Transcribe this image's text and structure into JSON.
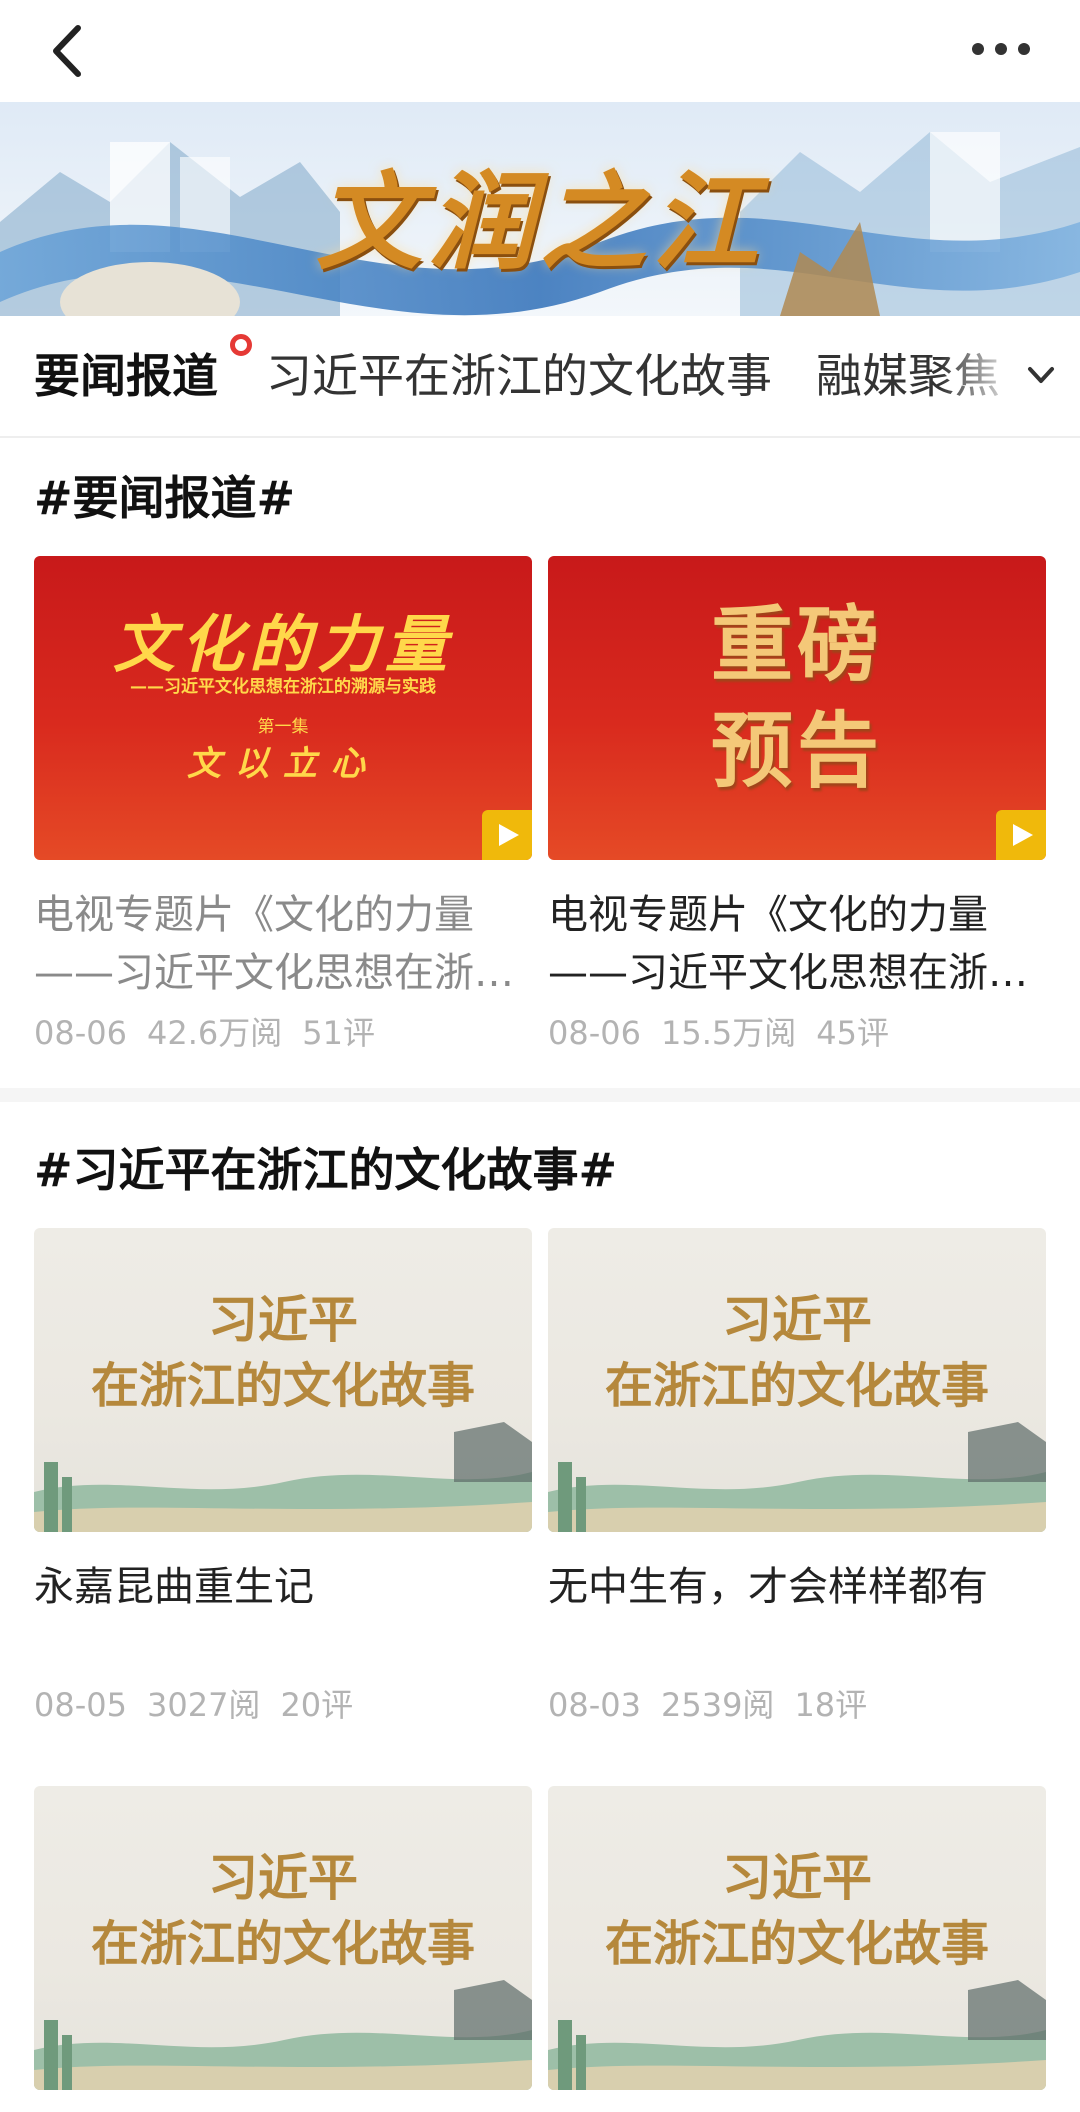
{
  "banner": {
    "title": "文润之江"
  },
  "tabs": [
    {
      "label": "要闻报道",
      "active": true
    },
    {
      "label": "习近平在浙江的文化故事",
      "active": false
    },
    {
      "label": "融媒聚焦",
      "active": false
    }
  ],
  "sections": [
    {
      "title": "#要闻报道#",
      "cards": [
        {
          "cover": {
            "style": "red",
            "main": "文化的力量",
            "sub": "——习近平文化思想在浙江的溯源与实践",
            "episode": "第一集",
            "episode_name": "文以立心"
          },
          "title_lines": [
            "电视专题片《文化的力量",
            "——习近平文化思想在浙江的溯源与实践"
          ],
          "date": "08-06",
          "reads": "42.6万阅",
          "comments": "51评",
          "video": true,
          "read_state": "muted"
        },
        {
          "cover": {
            "style": "red",
            "line1": "重磅",
            "line2": "预告"
          },
          "title_lines": [
            "电视专题片《文化的力量",
            "——习近平文化思想在浙江的溯源与实践"
          ],
          "date": "08-06",
          "reads": "15.5万阅",
          "comments": "45评",
          "video": true,
          "read_state": "normal"
        }
      ]
    },
    {
      "title": "#习近平在浙江的文化故事#",
      "cards": [
        {
          "cover": {
            "style": "cream",
            "line1": "习近平",
            "line2": "在浙江的文化故事"
          },
          "title_lines": [
            "永嘉昆曲重生记"
          ],
          "date": "08-05",
          "reads": "3027阅",
          "comments": "20评"
        },
        {
          "cover": {
            "style": "cream",
            "line1": "习近平",
            "line2": "在浙江的文化故事"
          },
          "title_lines": [
            "无中生有，才会样样都有"
          ],
          "date": "08-03",
          "reads": "2539阅",
          "comments": "18评"
        },
        {
          "cover": {
            "style": "cream",
            "line1": "习近平",
            "line2": "在浙江的文化故事"
          }
        },
        {
          "cover": {
            "style": "cream",
            "line1": "习近平",
            "line2": "在浙江的文化故事"
          }
        }
      ]
    }
  ],
  "colors": {
    "accent_dot": "#e53935",
    "play_badge": "#f0b90b",
    "meta_gray": "#b3b3b3"
  },
  "icons": [
    "back-icon",
    "more-icon",
    "chevron-down-icon",
    "play-icon"
  ]
}
